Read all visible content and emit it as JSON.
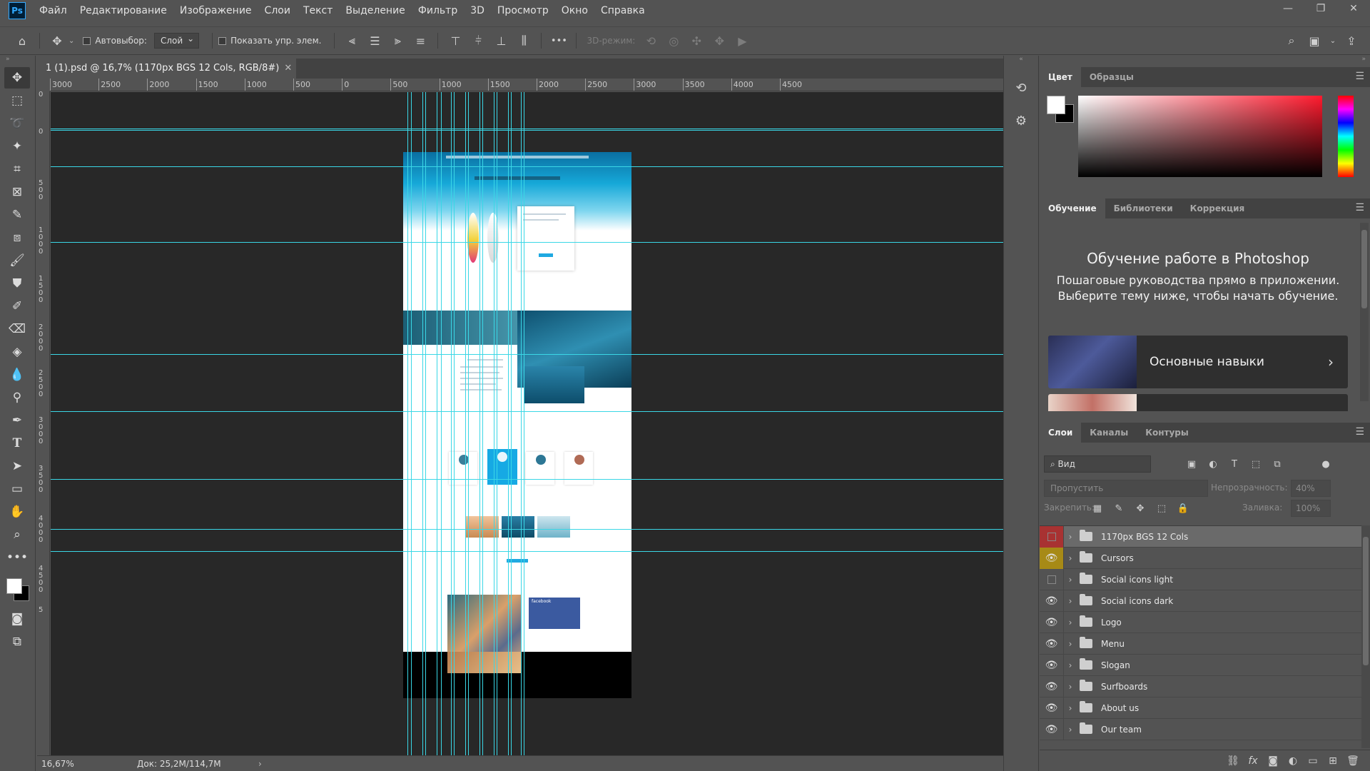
{
  "app": {
    "logo": "Ps"
  },
  "menu": [
    "Файл",
    "Редактирование",
    "Изображение",
    "Слои",
    "Текст",
    "Выделение",
    "Фильтр",
    "3D",
    "Просмотр",
    "Окно",
    "Справка"
  ],
  "options_bar": {
    "autoselect_label": "Автовыбор:",
    "autoselect_target": "Слой",
    "show_transform_label": "Показать упр. элем.",
    "more_label": "•••",
    "mode_3d_label": "3D-режим:"
  },
  "document": {
    "tab_title": "1 (1).psd @ 16,7% (1170px BGS 12 Cols, RGB/8#)",
    "close_glyph": "✕",
    "zoom": "16,67%",
    "doc_info": "Док: 25,2M/114,7M",
    "ruler_top_labels": [
      "3000",
      "2500",
      "2000",
      "1500",
      "1000",
      "500",
      "0",
      "500",
      "1000",
      "1500",
      "2000",
      "2500",
      "3000",
      "3500",
      "4000",
      "4500"
    ],
    "ruler_left_labels": [
      "5 0",
      "0",
      "5 0 0",
      "1 0 0 0",
      "1 5 0 0",
      "2 0 0 0",
      "2 5 0 0",
      "3 0 0 0",
      "3 5 0 0",
      "4 0 0 0",
      "4 5 0 0",
      "5"
    ]
  },
  "color_panel": {
    "tabs": [
      "Цвет",
      "Образцы"
    ],
    "foreground": "#ffffff",
    "background": "#000000",
    "hue_color": "#ff1a2e"
  },
  "learn_panel": {
    "tabs": [
      "Обучение",
      "Библиотеки",
      "Коррекция"
    ],
    "title": "Обучение работе в Photoshop",
    "subtitle": "Пошаговые руководства прямо в приложении. Выберите тему ниже, чтобы начать обучение.",
    "card_label": "Основные навыки"
  },
  "layers_panel": {
    "tabs": [
      "Слои",
      "Каналы",
      "Контуры"
    ],
    "filter_label": "Вид",
    "blend_mode": "Пропустить",
    "opacity_label": "Непрозрачность:",
    "opacity_value": "40%",
    "lock_label": "Закрепить:",
    "fill_label": "Заливка:",
    "fill_value": "100%",
    "layers": [
      {
        "name": "1170px BGS 12 Cols",
        "visible": false,
        "color": "red",
        "selected": true
      },
      {
        "name": "Cursors",
        "visible": true,
        "color": "yellow",
        "selected": false
      },
      {
        "name": "Social icons light",
        "visible": false,
        "color": "none",
        "selected": false
      },
      {
        "name": "Social icons dark",
        "visible": true,
        "color": "none",
        "selected": false
      },
      {
        "name": "Logo",
        "visible": true,
        "color": "none",
        "selected": false
      },
      {
        "name": "Menu",
        "visible": true,
        "color": "none",
        "selected": false
      },
      {
        "name": "Slogan",
        "visible": true,
        "color": "none",
        "selected": false
      },
      {
        "name": "Surfboards",
        "visible": true,
        "color": "none",
        "selected": false
      },
      {
        "name": "About us",
        "visible": true,
        "color": "none",
        "selected": false
      },
      {
        "name": "Our team",
        "visible": true,
        "color": "none",
        "selected": false
      }
    ],
    "footer_fx": "fx"
  },
  "artwork": {
    "facebook_label": "facebook"
  },
  "colors": {
    "guide": "#3ad7e6",
    "panel": "#535353",
    "canvas": "#282828",
    "accent": "#31a8ff"
  }
}
